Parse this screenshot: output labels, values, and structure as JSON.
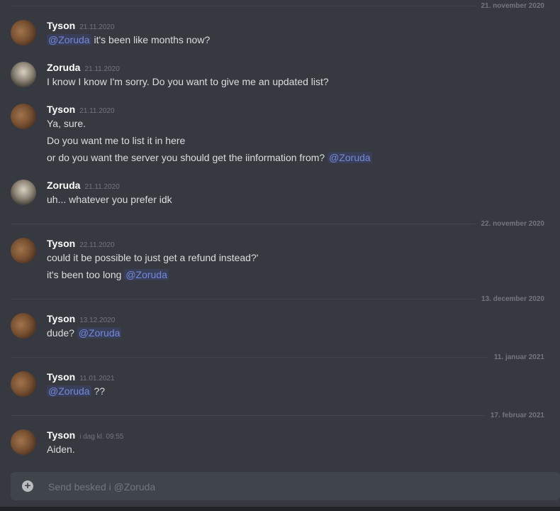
{
  "dividers": [
    "21. november 2020",
    "22. november 2020",
    "13. december 2020",
    "11. januar 2021",
    "17. februar 2021"
  ],
  "messages": [
    {
      "author": "Tyson",
      "timestamp": "21.11.2020",
      "lines": [
        {
          "mention_before": "@Zoruda",
          "text": " it's been like months now?"
        }
      ]
    },
    {
      "author": "Zoruda",
      "timestamp": "21.11.2020",
      "lines": [
        {
          "text": "I know I know I'm sorry. Do you want to give me an updated list?"
        }
      ]
    },
    {
      "author": "Tyson",
      "timestamp": "21.11.2020",
      "lines": [
        {
          "text": "Ya, sure."
        },
        {
          "text": "Do you want me to list it in here"
        },
        {
          "text": "or do you want the server you should get the iinformation from? ",
          "mention_after": "@Zoruda"
        }
      ]
    },
    {
      "author": "Zoruda",
      "timestamp": "21.11.2020",
      "lines": [
        {
          "text": "uh... whatever you prefer idk"
        }
      ]
    },
    {
      "author": "Tyson",
      "timestamp": "22.11.2020",
      "lines": [
        {
          "text": "could it be possible to just get a refund instead?'"
        },
        {
          "text": "it's been too long ",
          "mention_after": "@Zoruda"
        }
      ]
    },
    {
      "author": "Tyson",
      "timestamp": "13.12.2020",
      "lines": [
        {
          "text": "dude? ",
          "mention_after": "@Zoruda"
        }
      ]
    },
    {
      "author": "Tyson",
      "timestamp": "11.01.2021",
      "lines": [
        {
          "mention_before": "@Zoruda",
          "text": " ??"
        }
      ]
    },
    {
      "author": "Tyson",
      "timestamp": "i dag kl. 09:55",
      "lines": [
        {
          "text": "Aiden."
        }
      ]
    }
  ],
  "composer": {
    "placeholder": "Send besked i @Zoruda",
    "add_icon": "plus-circle-icon"
  }
}
